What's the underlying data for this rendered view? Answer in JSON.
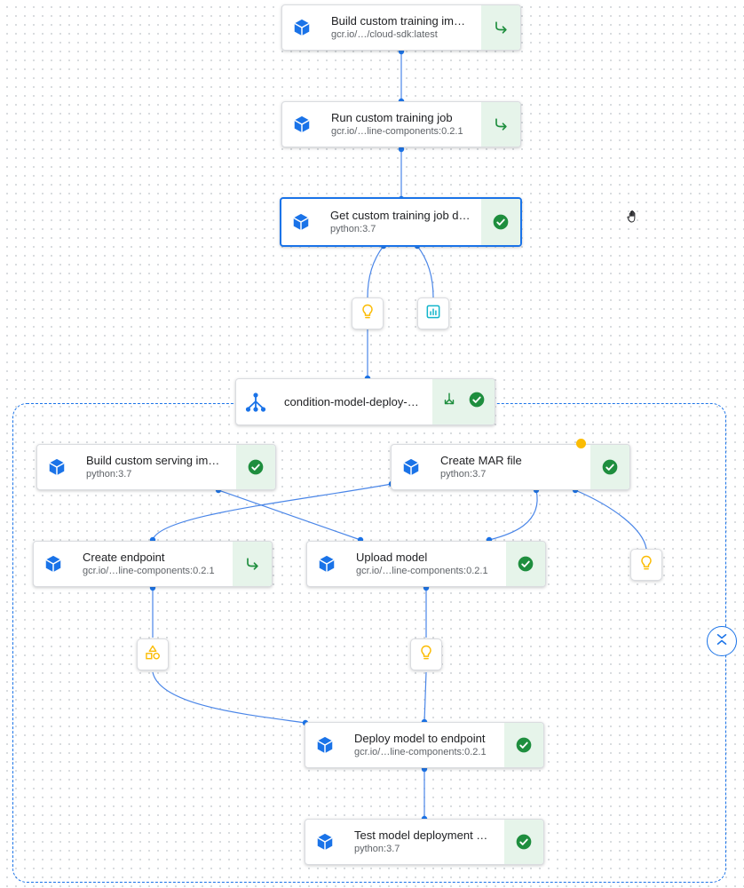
{
  "nodes": {
    "build_training": {
      "title": "Build custom training im…",
      "sub": "gcr.io/…/cloud-sdk:latest",
      "status": "cached"
    },
    "run_training": {
      "title": "Run custom training job",
      "sub": "gcr.io/…line-components:0.2.1",
      "status": "cached"
    },
    "get_training": {
      "title": "Get custom training job d…",
      "sub": "python:3.7",
      "status": "succeeded"
    },
    "condition": {
      "title": "condition-model-deploy-…",
      "status": "succeeded"
    },
    "build_serving": {
      "title": "Build custom serving im…",
      "sub": "python:3.7",
      "status": "succeeded"
    },
    "create_mar": {
      "title": "Create MAR file",
      "sub": "python:3.7",
      "status": "succeeded"
    },
    "create_endpoint": {
      "title": "Create endpoint",
      "sub": "gcr.io/…line-components:0.2.1",
      "status": "cached"
    },
    "upload_model": {
      "title": "Upload model",
      "sub": "gcr.io/…line-components:0.2.1",
      "status": "succeeded"
    },
    "deploy_model": {
      "title": "Deploy model to endpoint",
      "sub": "gcr.io/…line-components:0.2.1",
      "status": "succeeded"
    },
    "test_model": {
      "title": "Test model deployment …",
      "sub": "python:3.7",
      "status": "succeeded"
    }
  },
  "icons": {
    "component": "cube-icon",
    "condition": "fork-icon",
    "succeeded": "check-circle-icon",
    "cached": "cached-arrow-icon",
    "model_artifact": "lightbulb-icon",
    "metrics_artifact": "metrics-icon",
    "endpoint_artifact": "shapes-icon"
  },
  "colors": {
    "accent": "#1a73e8",
    "success": "#1e8e3e",
    "success_bg": "#e6f4ea",
    "artifact_yellow": "#fbbc04",
    "metrics_teal": "#12b5cb"
  }
}
